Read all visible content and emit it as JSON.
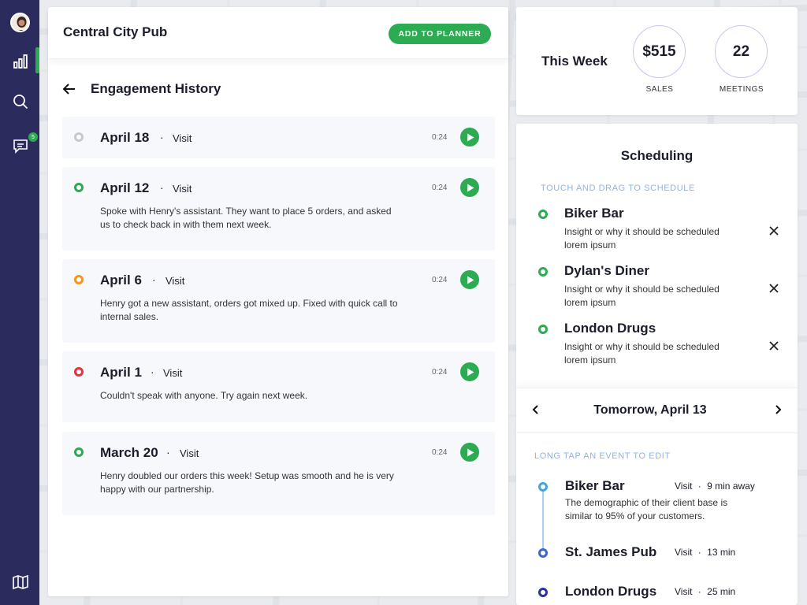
{
  "sidebar": {
    "icons": [
      "avatar",
      "bar-chart-icon",
      "search-icon",
      "chat-icon",
      "map-icon"
    ],
    "chat_badge": "5",
    "accent": "#2cab52",
    "background": "#2c2b5e"
  },
  "header": {
    "title": "Central City Pub",
    "planner_button": "ADD TO PLANNER"
  },
  "history": {
    "title": "Engagement History",
    "entries": [
      {
        "date": "April 18",
        "sep": "·",
        "type": "Visit",
        "duration": "0:24",
        "status": "grey",
        "note": ""
      },
      {
        "date": "April 12",
        "sep": "·",
        "type": "Visit",
        "duration": "0:24",
        "status": "green",
        "note": "Spoke with Henry's assistant. They want to place 5 orders, and asked us to check back in with them next week."
      },
      {
        "date": "April 6",
        "sep": "·",
        "type": "Visit",
        "duration": "0:24",
        "status": "orange",
        "note": "Henry got a new assistant, orders got mixed up. Fixed with quick call to internal sales."
      },
      {
        "date": "April 1",
        "sep": "·",
        "type": "Visit",
        "duration": "0:24",
        "status": "red",
        "note": "Couldn't speak with anyone. Try again next week."
      },
      {
        "date": "March 20",
        "sep": "·",
        "type": "Visit",
        "duration": "0:24",
        "status": "green",
        "note": "Henry doubled our orders this week! Setup was smooth and he is very happy with our partnership."
      }
    ]
  },
  "week": {
    "title": "This Week",
    "sales_value": "$515",
    "sales_label": "SALES",
    "meetings_value": "22",
    "meetings_label": "MEETINGS"
  },
  "scheduling": {
    "title": "Scheduling",
    "hint": "TOUCH AND DRAG TO SCHEDULE",
    "items": [
      {
        "name": "Biker Bar",
        "desc": "Insight or why it should be scheduled lorem ipsum"
      },
      {
        "name": "Dylan's Diner",
        "desc": "Insight or why it should be scheduled lorem ipsum"
      },
      {
        "name": "London Drugs",
        "desc": "Insight or why it should be scheduled lorem ipsum"
      }
    ]
  },
  "day": {
    "title": "Tomorrow, April 13",
    "hint": "LONG TAP AN EVENT TO EDIT",
    "events": [
      {
        "name": "Biker Bar",
        "type": "Visit",
        "sep": "·",
        "distance": "9 min away",
        "desc": "The demographic of their client base is similar to 95% of your customers."
      },
      {
        "name": "St. James Pub",
        "type": "Visit",
        "sep": "·",
        "distance": "13 min",
        "desc": ""
      },
      {
        "name": "London Drugs",
        "type": "Visit",
        "sep": "·",
        "distance": "25 min",
        "desc": ""
      }
    ]
  },
  "colors": {
    "green": "#2cab52",
    "orange": "#f7941d",
    "red": "#e8323c",
    "grey": "#c6c8cc",
    "timeline_blue": "#3ba6e0",
    "timeline_mid": "#3a63d8",
    "timeline_dark": "#2f2ca8"
  }
}
